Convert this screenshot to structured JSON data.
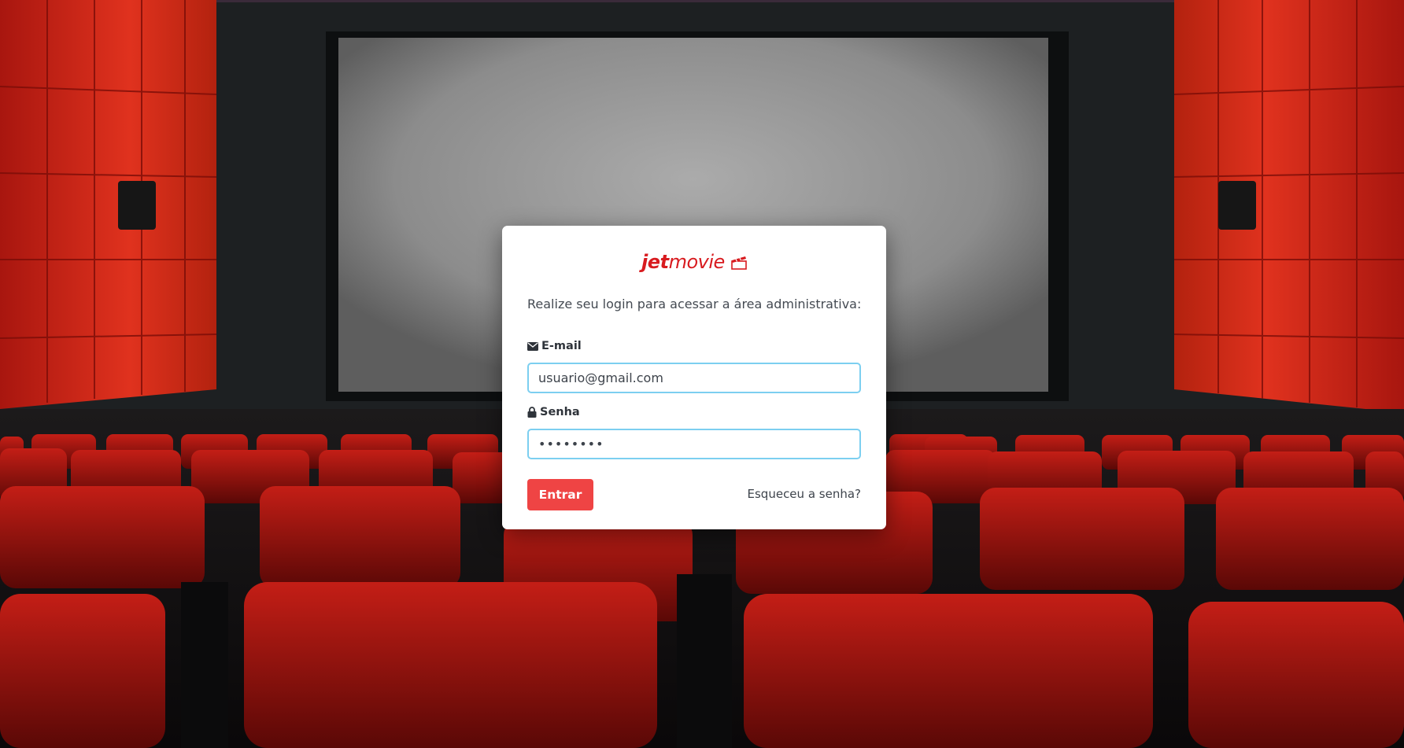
{
  "brand": {
    "logo_bold": "jet",
    "logo_regular": "movie",
    "color": "#d81b1f"
  },
  "login": {
    "intro": "Realize seu login para acessar a área administrativa:",
    "email_label": "E-mail",
    "email_value": "usuario@gmail.com",
    "password_label": "Senha",
    "password_value": "12345678",
    "submit_label": "Entrar",
    "forgot_label": "Esqueceu a senha?"
  },
  "icons": {
    "email": "envelope-icon",
    "password": "lock-icon",
    "logo": "clapperboard-icon"
  },
  "colors": {
    "accent": "#ef4444",
    "focus_border": "#7ccff0",
    "card": "#ffffff"
  }
}
